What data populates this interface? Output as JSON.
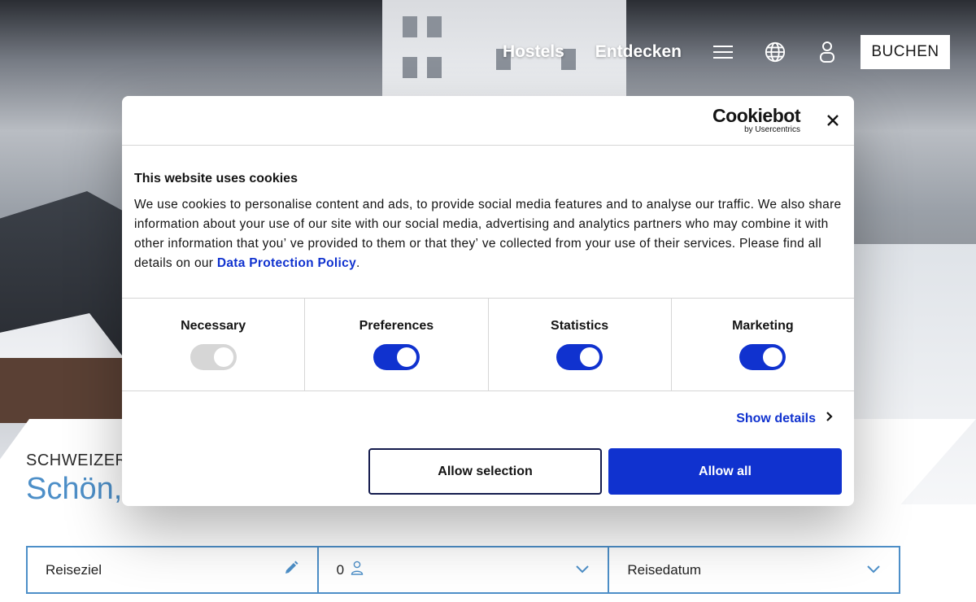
{
  "site_nav": {
    "links": [
      "Hostels",
      "Entdecken"
    ],
    "menu_icon": "hamburger-menu-icon",
    "language_icon": "globe-icon",
    "account_icon": "user-icon",
    "book_label": "BUCHEN"
  },
  "hero": {
    "eyebrow": "SCHWEIZER",
    "headline": "Schön,"
  },
  "search": {
    "destination_label": "Reiseziel",
    "destination_icon": "pencil-icon",
    "guests_value": "0",
    "guests_icon": "person-icon",
    "date_label": "Reisedatum",
    "chevron_icon": "chevron-down-icon"
  },
  "cookie_dialog": {
    "brand_name": "Cookiebot",
    "brand_sub": "by Usercentrics",
    "close_icon": "close-icon",
    "title": "This website uses cookies",
    "text_before_link": "We use cookies to personalise content and ads, to provide social media features and to analyse our traffic. We also share information about your use of our site with our social media, advertising and analytics partners who may combine it with other information that you’ ve provided to them or that they’ ve collected from your use of their services. Please find all details on our ",
    "link_text": "Data Protection Policy",
    "text_after_link": ".",
    "categories": [
      {
        "label": "Necessary",
        "enabled": true,
        "locked": true
      },
      {
        "label": "Preferences",
        "enabled": true,
        "locked": false
      },
      {
        "label": "Statistics",
        "enabled": true,
        "locked": false
      },
      {
        "label": "Marketing",
        "enabled": true,
        "locked": false
      }
    ],
    "show_details_label": "Show details",
    "allow_selection_label": "Allow selection",
    "allow_all_label": "Allow all",
    "accent_color": "#1032cf"
  }
}
